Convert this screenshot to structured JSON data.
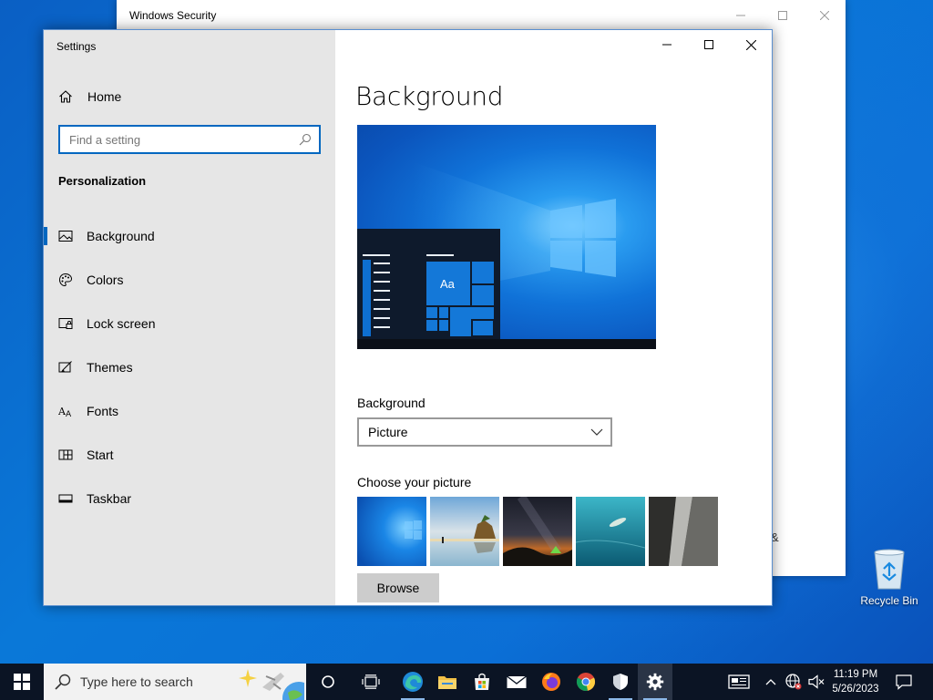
{
  "security_window": {
    "title": "Windows Security",
    "fragment_text": "&"
  },
  "settings": {
    "title": "Settings",
    "home_label": "Home",
    "search_placeholder": "Find a setting",
    "section_title": "Personalization",
    "nav_items": [
      {
        "label": "Background",
        "icon": "picture-icon",
        "selected": true
      },
      {
        "label": "Colors",
        "icon": "palette-icon"
      },
      {
        "label": "Lock screen",
        "icon": "lock-screen-icon"
      },
      {
        "label": "Themes",
        "icon": "themes-icon"
      },
      {
        "label": "Fonts",
        "icon": "fonts-icon"
      },
      {
        "label": "Start",
        "icon": "start-icon"
      },
      {
        "label": "Taskbar",
        "icon": "taskbar-icon"
      }
    ],
    "page_title": "Background",
    "preview_tile_text": "Aa",
    "background_label": "Background",
    "background_value": "Picture",
    "choose_picture_label": "Choose your picture",
    "pictures": [
      "windows-blue-wallpaper",
      "beach-rock-wallpaper",
      "night-sky-tent-wallpaper",
      "underwater-swimmer-wallpaper",
      "rock-cliff-wallpaper"
    ],
    "browse_label": "Browse"
  },
  "desktop": {
    "recycle_bin_label": "Recycle Bin"
  },
  "taskbar": {
    "search_placeholder": "Type here to search",
    "apps": [
      "cortana-icon",
      "task-view-icon",
      "edge-icon",
      "file-explorer-icon",
      "store-icon",
      "mail-icon",
      "firefox-icon",
      "chrome-icon",
      "windows-security-icon",
      "settings-icon"
    ],
    "time": "11:19 PM",
    "date": "5/26/2023"
  },
  "colors": {
    "accent": "#0067c0",
    "sidebar": "#e6e6e6",
    "taskbar": "#0b1424"
  }
}
